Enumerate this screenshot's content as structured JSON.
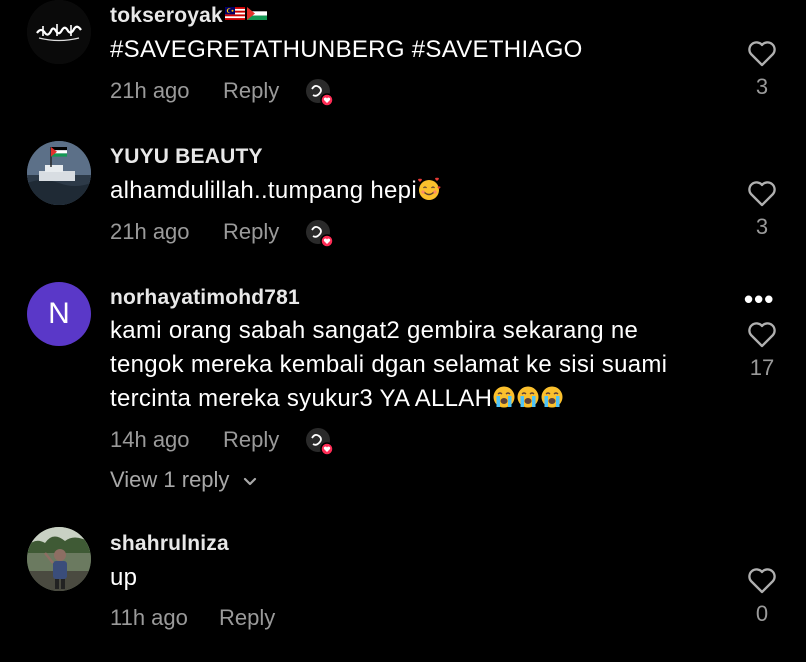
{
  "comments": [
    {
      "username": "tokseroyak",
      "flag_icons": [
        "malaysia-flag-icon",
        "palestine-flag-icon"
      ],
      "text": "#SAVEGRETATHUNBERG #SAVETHIAGO",
      "time": "21h ago",
      "reply_label": "Reply",
      "likes": "3",
      "creator_liked": true
    },
    {
      "username": "YUYU BEAUTY",
      "text": "alhamdulillah..tumpang hepi",
      "emoji_icons": [
        "smiling-face-with-hearts-emoji"
      ],
      "time": "21h ago",
      "reply_label": "Reply",
      "likes": "3",
      "creator_liked": true
    },
    {
      "username": "norhayatimohd781",
      "avatar_letter": "N",
      "text_lines": [
        "kami orang sabah sangat2 gembira sekarang ne",
        "tengok mereka kembali dgan selamat ke sisi suami",
        "tercinta mereka syukur3 YA ALLAH"
      ],
      "emoji_icons": [
        "loudly-crying-face-emoji",
        "loudly-crying-face-emoji",
        "loudly-crying-face-emoji"
      ],
      "time": "14h ago",
      "reply_label": "Reply",
      "likes": "17",
      "creator_liked": true,
      "more_label": "•••",
      "view_replies_label": "View 1 reply"
    },
    {
      "username": "shahrulniza",
      "text": "up",
      "time": "11h ago",
      "reply_label": "Reply",
      "likes": "0",
      "creator_liked": false
    }
  ],
  "icons": {
    "heart": "heart-outline-icon",
    "chevron": "chevron-down-icon",
    "creator_like": "creator-liked-icon"
  },
  "colors": {
    "background": "#000000",
    "text_primary": "#ffffff",
    "text_secondary": "#9a9a9a",
    "accent_heart": "#fe2c55",
    "letter_avatar_bg": "#5a38c8"
  }
}
